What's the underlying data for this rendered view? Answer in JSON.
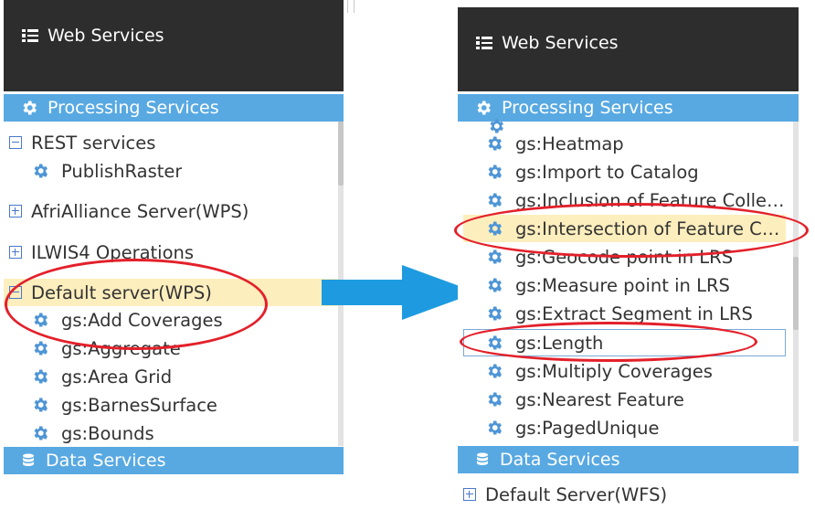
{
  "left": {
    "header_title": "Web Services",
    "processing_label": "Processing Services",
    "items": [
      {
        "type": "group-open",
        "label": "REST services"
      },
      {
        "type": "service",
        "label": "PublishRaster"
      },
      {
        "type": "group-closed",
        "label": "AfriAlliance Server(WPS)"
      },
      {
        "type": "group-closed",
        "label": "ILWIS4 Operations"
      },
      {
        "type": "group-open",
        "label": "Default server(WPS)"
      },
      {
        "type": "service",
        "label": "gs:Add Coverages"
      },
      {
        "type": "service",
        "label": "gs:Aggregate"
      },
      {
        "type": "service",
        "label": "gs:Area Grid"
      },
      {
        "type": "service",
        "label": "gs:BarnesSurface"
      },
      {
        "type": "service",
        "label": "gs:Bounds"
      }
    ],
    "data_label": "Data Services"
  },
  "right": {
    "header_title": "Web Services",
    "processing_label": "Processing Services",
    "items": [
      {
        "label": "gs:Heatmap"
      },
      {
        "label": "gs:Import to Catalog"
      },
      {
        "label": "gs:Inclusion of Feature Collecti..."
      },
      {
        "label": "gs:Intersection of Feature Coll..."
      },
      {
        "label": "gs:Geocode point in LRS"
      },
      {
        "label": "gs:Measure point in LRS"
      },
      {
        "label": "gs:Extract Segment in LRS"
      },
      {
        "label": "gs:Length"
      },
      {
        "label": "gs:Multiply Coverages"
      },
      {
        "label": "gs:Nearest Feature"
      },
      {
        "label": "gs:PagedUnique"
      }
    ],
    "data_label": "Data Services",
    "data_items": [
      {
        "label": "Default Server(WFS)"
      }
    ]
  },
  "colors": {
    "header_bg": "#2d2d2d",
    "section_bg": "#58a9e2",
    "selected_bg": "#fdeebd",
    "icon_blue": "#4e95d6",
    "annotation_red": "#e3202a",
    "arrow_blue": "#1e9be0"
  },
  "icons": {
    "header": "list-icon",
    "processing": "gear-icon",
    "service": "gear-icon",
    "data": "database-icon"
  }
}
